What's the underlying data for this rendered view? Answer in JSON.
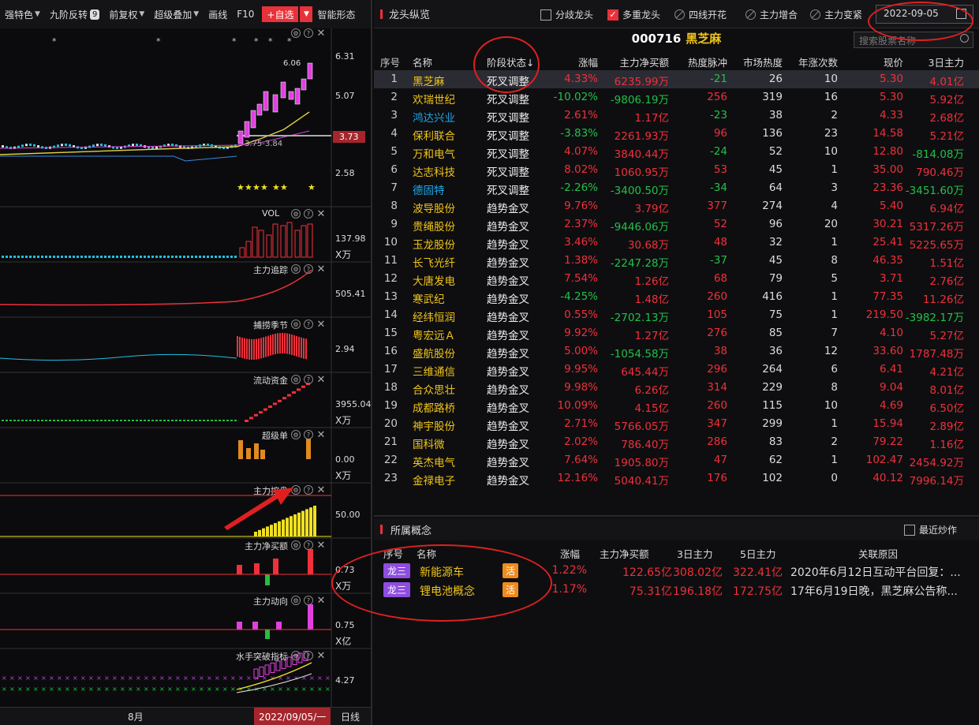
{
  "toolbar": {
    "items": [
      "强特色",
      "九阶反转",
      "前复权",
      "超级叠加",
      "画线",
      "F10"
    ],
    "badge": "9",
    "add_label": "+自选",
    "smart_label": "智能形态"
  },
  "chart": {
    "price_labels": [
      "6.31",
      "5.07",
      "3.73",
      "2.58"
    ],
    "high_label": "6.06",
    "low_label": "3.75-3.84",
    "panels": [
      {
        "title": "VOL",
        "value": "137.98",
        "unit": "X万"
      },
      {
        "title": "主力追踪",
        "value": "505.41",
        "unit": ""
      },
      {
        "title": "捕捞季节",
        "value": "2.94",
        "unit": ""
      },
      {
        "title": "流动资金",
        "value": "3955.04",
        "unit": "X万"
      },
      {
        "title": "超级单",
        "value": "0.00",
        "unit": "X万"
      },
      {
        "title": "主力控盘",
        "value": "50.00",
        "unit": ""
      },
      {
        "title": "主力净买额",
        "value": "0.73",
        "unit": "X万"
      },
      {
        "title": "主力动向",
        "value": "0.75",
        "unit": "X亿"
      },
      {
        "title": "水手突破指标",
        "value": "4.27",
        "unit": ""
      }
    ],
    "month_label": "8月",
    "current_date": "2022/09/05/一",
    "period_label": "日线"
  },
  "right": {
    "title": "龙头纵览",
    "options": [
      {
        "label": "分歧龙头",
        "checked": false
      },
      {
        "label": "多重龙头",
        "checked": true
      },
      {
        "label": "四线开花",
        "checked": false
      },
      {
        "label": "主力增合",
        "checked": false
      },
      {
        "label": "主力变紧",
        "checked": false
      }
    ],
    "date": "2022-09-05",
    "stock_code": "000716",
    "stock_name": "黑芝麻",
    "search_placeholder": "搜索股票名称",
    "columns": [
      "序号",
      "名称",
      "阶段状态↓",
      "涨幅",
      "主力净买额",
      "热度脉冲",
      "市场热度",
      "年涨次数",
      "现价",
      "3日主力"
    ],
    "rows": [
      {
        "idx": "1",
        "name": "黑芝麻",
        "stage": "死叉调整",
        "chg": "4.33%",
        "net": "6235.99万",
        "pulse": "-21",
        "heat": "26",
        "times": "10",
        "price": "5.30",
        "d3": "4.01亿"
      },
      {
        "idx": "2",
        "name": "欢瑞世纪",
        "stage": "死叉调整",
        "chg": "-10.02%",
        "net": "-9806.19万",
        "pulse": "256",
        "heat": "319",
        "times": "16",
        "price": "5.30",
        "d3": "5.92亿"
      },
      {
        "idx": "3",
        "name": "鸿达兴业",
        "stage": "死叉调整",
        "chg": "2.61%",
        "net": "1.17亿",
        "pulse": "-23",
        "heat": "38",
        "times": "2",
        "price": "4.33",
        "d3": "2.68亿"
      },
      {
        "idx": "4",
        "name": "保利联合",
        "stage": "死叉调整",
        "chg": "-3.83%",
        "net": "2261.93万",
        "pulse": "96",
        "heat": "136",
        "times": "23",
        "price": "14.58",
        "d3": "5.21亿"
      },
      {
        "idx": "5",
        "name": "万和电气",
        "stage": "死叉调整",
        "chg": "4.07%",
        "net": "3840.44万",
        "pulse": "-24",
        "heat": "52",
        "times": "10",
        "price": "12.80",
        "d3": "-814.08万"
      },
      {
        "idx": "6",
        "name": "达志科技",
        "stage": "死叉调整",
        "chg": "8.02%",
        "net": "1060.95万",
        "pulse": "53",
        "heat": "45",
        "times": "1",
        "price": "35.00",
        "d3": "790.46万"
      },
      {
        "idx": "7",
        "name": "德固特",
        "stage": "死叉调整",
        "chg": "-2.26%",
        "net": "-3400.50万",
        "pulse": "-34",
        "heat": "64",
        "times": "3",
        "price": "23.36",
        "d3": "-3451.60万"
      },
      {
        "idx": "8",
        "name": "波导股份",
        "stage": "趋势金叉",
        "chg": "9.76%",
        "net": "3.79亿",
        "pulse": "377",
        "heat": "274",
        "times": "4",
        "price": "5.40",
        "d3": "6.94亿"
      },
      {
        "idx": "9",
        "name": "贵绳股份",
        "stage": "趋势金叉",
        "chg": "2.37%",
        "net": "-9446.06万",
        "pulse": "52",
        "heat": "96",
        "times": "20",
        "price": "30.21",
        "d3": "5317.26万"
      },
      {
        "idx": "10",
        "name": "玉龙股份",
        "stage": "趋势金叉",
        "chg": "3.46%",
        "net": "30.68万",
        "pulse": "48",
        "heat": "32",
        "times": "1",
        "price": "25.41",
        "d3": "5225.65万"
      },
      {
        "idx": "11",
        "name": "长飞光纤",
        "stage": "趋势金叉",
        "chg": "1.38%",
        "net": "-2247.28万",
        "pulse": "-37",
        "heat": "45",
        "times": "8",
        "price": "46.35",
        "d3": "1.51亿"
      },
      {
        "idx": "12",
        "name": "大唐发电",
        "stage": "趋势金叉",
        "chg": "7.54%",
        "net": "1.26亿",
        "pulse": "68",
        "heat": "79",
        "times": "5",
        "price": "3.71",
        "d3": "2.76亿"
      },
      {
        "idx": "13",
        "name": "寒武纪",
        "stage": "趋势金叉",
        "chg": "-4.25%",
        "net": "1.48亿",
        "pulse": "260",
        "heat": "416",
        "times": "1",
        "price": "77.35",
        "d3": "11.26亿"
      },
      {
        "idx": "14",
        "name": "经纬恒润",
        "stage": "趋势金叉",
        "chg": "0.55%",
        "net": "-2702.13万",
        "pulse": "105",
        "heat": "75",
        "times": "1",
        "price": "219.50",
        "d3": "-3982.17万"
      },
      {
        "idx": "15",
        "name": "粤宏远Ａ",
        "stage": "趋势金叉",
        "chg": "9.92%",
        "net": "1.27亿",
        "pulse": "276",
        "heat": "85",
        "times": "7",
        "price": "4.10",
        "d3": "5.27亿"
      },
      {
        "idx": "16",
        "name": "盛航股份",
        "stage": "趋势金叉",
        "chg": "5.00%",
        "net": "-1054.58万",
        "pulse": "38",
        "heat": "36",
        "times": "12",
        "price": "33.60",
        "d3": "1787.48万"
      },
      {
        "idx": "17",
        "name": "三维通信",
        "stage": "趋势金叉",
        "chg": "9.95%",
        "net": "645.44万",
        "pulse": "296",
        "heat": "264",
        "times": "6",
        "price": "6.41",
        "d3": "4.21亿"
      },
      {
        "idx": "18",
        "name": "合众思壮",
        "stage": "趋势金叉",
        "chg": "9.98%",
        "net": "6.26亿",
        "pulse": "314",
        "heat": "229",
        "times": "8",
        "price": "9.04",
        "d3": "8.01亿"
      },
      {
        "idx": "19",
        "name": "成都路桥",
        "stage": "趋势金叉",
        "chg": "10.09%",
        "net": "4.15亿",
        "pulse": "260",
        "heat": "115",
        "times": "10",
        "price": "4.69",
        "d3": "6.50亿"
      },
      {
        "idx": "20",
        "name": "神宇股份",
        "stage": "趋势金叉",
        "chg": "2.71%",
        "net": "5766.05万",
        "pulse": "347",
        "heat": "299",
        "times": "1",
        "price": "15.94",
        "d3": "2.89亿"
      },
      {
        "idx": "21",
        "name": "国科微",
        "stage": "趋势金叉",
        "chg": "2.02%",
        "net": "786.40万",
        "pulse": "286",
        "heat": "83",
        "times": "2",
        "price": "79.22",
        "d3": "1.16亿"
      },
      {
        "idx": "22",
        "name": "英杰电气",
        "stage": "趋势金叉",
        "chg": "7.64%",
        "net": "1905.80万",
        "pulse": "47",
        "heat": "62",
        "times": "1",
        "price": "102.47",
        "d3": "2454.92万"
      },
      {
        "idx": "23",
        "name": "金禄电子",
        "stage": "趋势金叉",
        "chg": "12.16%",
        "net": "5040.41万",
        "pulse": "176",
        "heat": "102",
        "times": "0",
        "price": "40.12",
        "d3": "7996.14万"
      }
    ],
    "name_colors": {
      "鸿达兴业": "#1ea7e8",
      "德固特": "#1ea7e8"
    },
    "concepts_title": "所属概念",
    "recent_label": "最近炒作",
    "concept_columns": [
      "序号",
      "名称",
      "涨幅",
      "主力净买额",
      "3日主力",
      "5日主力",
      "关联原因"
    ],
    "concepts": [
      {
        "tag": "龙三",
        "name": "新能源车",
        "active": "活",
        "chg": "1.22%",
        "net": "122.65亿",
        "d3": "308.02亿",
        "d5": "322.41亿",
        "reason": "2020年6月12日互动平台回复：..."
      },
      {
        "tag": "龙三",
        "name": "锂电池概念",
        "active": "活",
        "chg": "1.17%",
        "net": "75.31亿",
        "d3": "196.18亿",
        "d5": "172.75亿",
        "reason": "17年6月19日晚，黑芝麻公告称..."
      }
    ]
  }
}
